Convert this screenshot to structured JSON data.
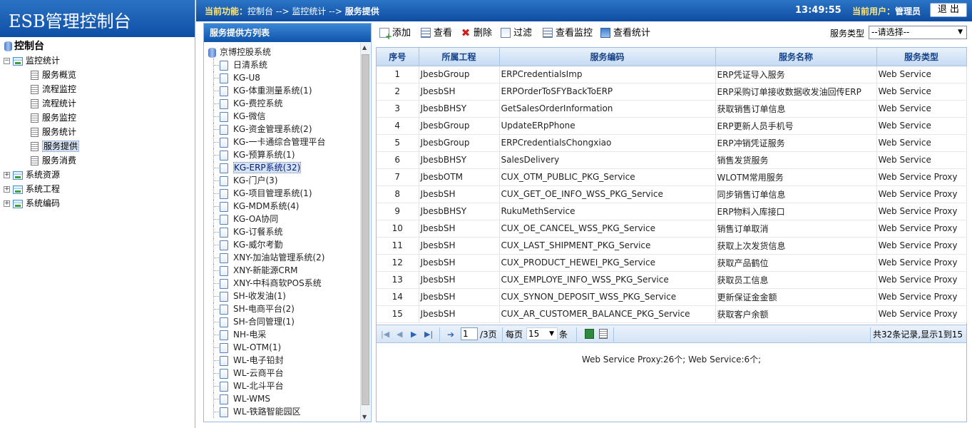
{
  "app_title": "ESB管理控制台",
  "sidebar": {
    "root": "控制台",
    "groups": [
      {
        "label": "监控统计",
        "expanded": true,
        "items": [
          "服务概览",
          "流程监控",
          "流程统计",
          "服务监控",
          "服务统计",
          "服务提供",
          "服务消费"
        ],
        "selected": "服务提供"
      },
      {
        "label": "系统资源",
        "expanded": false
      },
      {
        "label": "系统工程",
        "expanded": false
      },
      {
        "label": "系统编码",
        "expanded": false
      }
    ]
  },
  "topbar": {
    "crumb_label": "当前功能：",
    "crumb_path": "控制台 --> 监控统计 --> ",
    "crumb_current": "服务提供",
    "clock": "13:49:55",
    "user_label": "当前用户：",
    "user_name": "管理员",
    "logout": "退 出"
  },
  "service_tree": {
    "title": "服务提供方列表",
    "root": "京博控股系统",
    "items": [
      "日清系统",
      "KG-U8",
      "KG-体重测量系统(1)",
      "KG-费控系统",
      "KG-微信",
      "KG-资金管理系统(2)",
      "KG-一卡通综合管理平台",
      "KG-预算系统(1)",
      "KG-ERP系统(32)",
      "KG-门户(3)",
      "KG-项目管理系统(1)",
      "KG-MDM系统(4)",
      "KG-OA协同",
      "KG-订餐系统",
      "KG-威尔考勤",
      "XNY-加油站管理系统(2)",
      "XNY-新能源CRM",
      "XNY-中科商软POS系统",
      "SH-收发油(1)",
      "SH-电商平台(2)",
      "SH-合同管理(1)",
      "NH-电采",
      "WL-OTM(1)",
      "WL-电子铅封",
      "WL-云商平台",
      "WL-北斗平台",
      "WL-WMS",
      "WL-铁路智能园区"
    ],
    "selected": "KG-ERP系统(32)"
  },
  "toolbar": {
    "add": "添加",
    "view": "查看",
    "delete": "删除",
    "filter": "过滤",
    "view_monitor": "查看监控",
    "view_stats": "查看统计",
    "service_type_label": "服务类型",
    "service_type_value": "--请选择--"
  },
  "grid": {
    "columns": [
      "序号",
      "所属工程",
      "服务编码",
      "服务名称",
      "服务类型"
    ],
    "rows": [
      [
        "1",
        "JbesbGroup",
        "ERPCredentialsImp",
        "ERP凭证导入服务",
        "Web Service"
      ],
      [
        "2",
        "JbesbSH",
        "ERPOrderToSFYBackToERP",
        "ERP采购订单接收数据收发油回传ERP",
        "Web Service"
      ],
      [
        "3",
        "JbesbBHSY",
        "GetSalesOrderInformation",
        "获取销售订单信息",
        "Web Service"
      ],
      [
        "4",
        "JbesbGroup",
        "UpdateERpPhone",
        "ERP更新人员手机号",
        "Web Service"
      ],
      [
        "5",
        "JbesbGroup",
        "ERPCredentialsChongxiao",
        "ERP冲销凭证服务",
        "Web Service"
      ],
      [
        "6",
        "JbesbBHSY",
        "SalesDelivery",
        "销售发货服务",
        "Web Service"
      ],
      [
        "7",
        "JbesbOTM",
        "CUX_OTM_PUBLIC_PKG_Service",
        "WLOTM常用服务",
        "Web Service Proxy"
      ],
      [
        "8",
        "JbesbSH",
        "CUX_GET_OE_INFO_WSS_PKG_Service",
        "同步销售订单信息",
        "Web Service Proxy"
      ],
      [
        "9",
        "JbesbBHSY",
        "RukuMethService",
        "ERP物料入库接口",
        "Web Service Proxy"
      ],
      [
        "10",
        "JbesbSH",
        "CUX_OE_CANCEL_WSS_PKG_Service",
        "销售订单取消",
        "Web Service Proxy"
      ],
      [
        "11",
        "JbesbSH",
        "CUX_LAST_SHIPMENT_PKG_Service",
        "获取上次发货信息",
        "Web Service Proxy"
      ],
      [
        "12",
        "JbesbSH",
        "CUX_PRODUCT_HEWEI_PKG_Service",
        "获取产品鹤位",
        "Web Service Proxy"
      ],
      [
        "13",
        "JbesbSH",
        "CUX_EMPLOYE_INFO_WSS_PKG_Service",
        "获取员工信息",
        "Web Service Proxy"
      ],
      [
        "14",
        "JbesbSH",
        "CUX_SYNON_DEPOSIT_WSS_PKG_Service",
        "更新保证金金额",
        "Web Service Proxy"
      ],
      [
        "15",
        "JbesbSH",
        "CUX_AR_CUSTOMER_BALANCE_PKG_Service",
        "获取客户余额",
        "Web Service Proxy"
      ]
    ]
  },
  "pager": {
    "page": "1",
    "total_pages": "/3页",
    "per_page_label": "每页",
    "per_page": "15",
    "per_page_unit": "条",
    "summary": "共32条记录,显示1到15"
  },
  "summary_text": "Web Service Proxy:26个; Web Service:6个;"
}
